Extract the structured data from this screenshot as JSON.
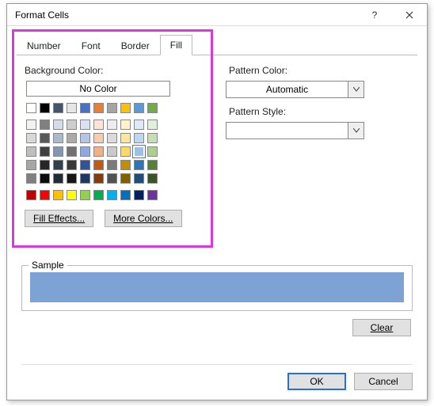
{
  "dialog": {
    "title": "Format Cells"
  },
  "tabs": {
    "number": "Number",
    "font": "Font",
    "border": "Border",
    "fill": "Fill"
  },
  "fill": {
    "bg_label": "Background Color:",
    "no_color": "No Color",
    "fill_effects": "Fill Effects...",
    "more_colors": "More Colors...",
    "pattern_color_label": "Pattern Color:",
    "pattern_color_value": "Automatic",
    "pattern_style_label": "Pattern Style:",
    "pattern_style_value": ""
  },
  "theme_row1": [
    "#ffffff",
    "#000000",
    "#44546a",
    "#e7e6e6",
    "#4472c4",
    "#ed7d31",
    "#a5a5a5",
    "#ffc000",
    "#5b9bd5",
    "#70ad47"
  ],
  "theme_grid": [
    [
      "#f2f2f2",
      "#808080",
      "#d6dce5",
      "#cfcdcd",
      "#d9e1f2",
      "#fce4d6",
      "#ededed",
      "#fff2cc",
      "#ddebf7",
      "#e2efda"
    ],
    [
      "#d9d9d9",
      "#595959",
      "#acb9ca",
      "#aeaaaa",
      "#b4c6e7",
      "#f8cbad",
      "#dbdbdb",
      "#ffe699",
      "#bdd7ee",
      "#c6e0b4"
    ],
    [
      "#bfbfbf",
      "#404040",
      "#8497b0",
      "#757171",
      "#8ea9db",
      "#f4b084",
      "#c9c9c9",
      "#ffd966",
      "#9bc2e6",
      "#a9d08e"
    ],
    [
      "#a6a6a6",
      "#262626",
      "#333f4f",
      "#3a3838",
      "#305496",
      "#c65911",
      "#7b7b7b",
      "#bf8f00",
      "#2f75b5",
      "#548235"
    ],
    [
      "#808080",
      "#0d0d0d",
      "#222b35",
      "#161616",
      "#203764",
      "#833c0c",
      "#525252",
      "#806000",
      "#1f4e78",
      "#375623"
    ]
  ],
  "standard_row": [
    "#c00000",
    "#ff0000",
    "#ffc000",
    "#ffff00",
    "#92d050",
    "#00b050",
    "#00b0f0",
    "#0070c0",
    "#002060",
    "#7030a0"
  ],
  "selected": {
    "group": "theme_grid",
    "row": 2,
    "col": 8
  },
  "sample": {
    "label": "Sample",
    "color": "#7da2d4"
  },
  "buttons": {
    "clear": "Clear",
    "ok": "OK",
    "cancel": "Cancel"
  }
}
